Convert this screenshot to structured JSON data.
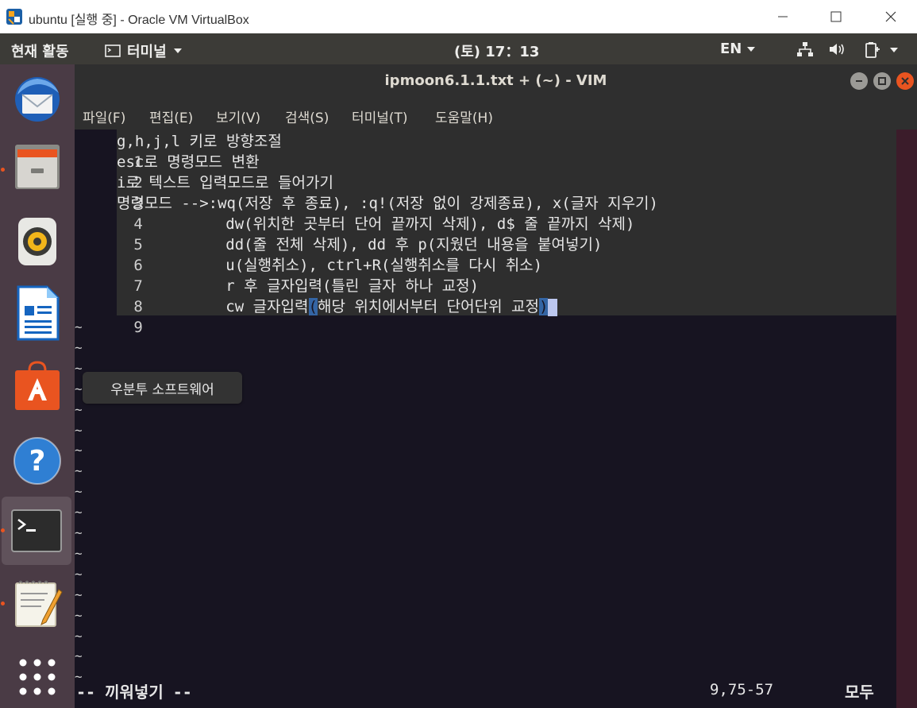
{
  "host": {
    "title": "ubuntu [실행 중] - Oracle VM VirtualBox",
    "minimize": "─",
    "maximize": "☐",
    "close": "✕"
  },
  "topbar": {
    "activities": "현재 활동",
    "app_menu": "터미널",
    "clock": "(토) 17：13",
    "input_lang": "EN"
  },
  "dock": {
    "tooltip": "우분투 소프트웨어",
    "items": [
      "thunderbird-mail",
      "files",
      "rhythmbox",
      "libreoffice-writer",
      "ubuntu-software",
      "help",
      "terminal",
      "text-editor",
      "show-applications"
    ]
  },
  "terminal": {
    "title": "ipmoon6.1.1.txt + (~) - VIM",
    "menus": [
      "파일(F)",
      "편집(E)",
      "보기(V)",
      "검색(S)",
      "터미널(T)",
      "도움말(H)"
    ]
  },
  "vim": {
    "lines": [
      {
        "num": "1",
        "text": "g,h,j,l 키로 방향조절"
      },
      {
        "num": "2",
        "text": "esc로 명령모드 변환"
      },
      {
        "num": "3",
        "text": "i로 텍스트 입력모드로 들어가기"
      },
      {
        "num": "4",
        "text": "명령모드 -->:wq(저장 후 종료), :q!(저장 없이 강제종료), x(글자 지우기)"
      },
      {
        "num": "5",
        "text": "            dw(위치한 곳부터 단어 끝까지 삭제), d$ 줄 끝까지 삭제)"
      },
      {
        "num": "6",
        "text": "            dd(줄 전체 삭제), dd 후 p(지웠던 내용을 붙여넣기)"
      },
      {
        "num": "7",
        "text": "            u(실행취소), ctrl+R(실행취소를 다시 취소)"
      },
      {
        "num": "8",
        "text": "            r 후 글자입력(틀린 글자 하나 교정)"
      }
    ],
    "line9": {
      "num": "9",
      "prefix": "            cw 글자입력",
      "open_paren": "(",
      "middle": "해당 위치에서부터 단어단위 교정",
      "close_paren": ")"
    },
    "tilde": "~",
    "mode": "-- 끼워넣기 --",
    "position": "9,75-57",
    "scroll": "모두"
  },
  "colors": {
    "accent": "#e95420",
    "terminal_bg": "#171421",
    "dock_bg": "#4a3b45",
    "topbar_bg": "#3c3b37"
  }
}
